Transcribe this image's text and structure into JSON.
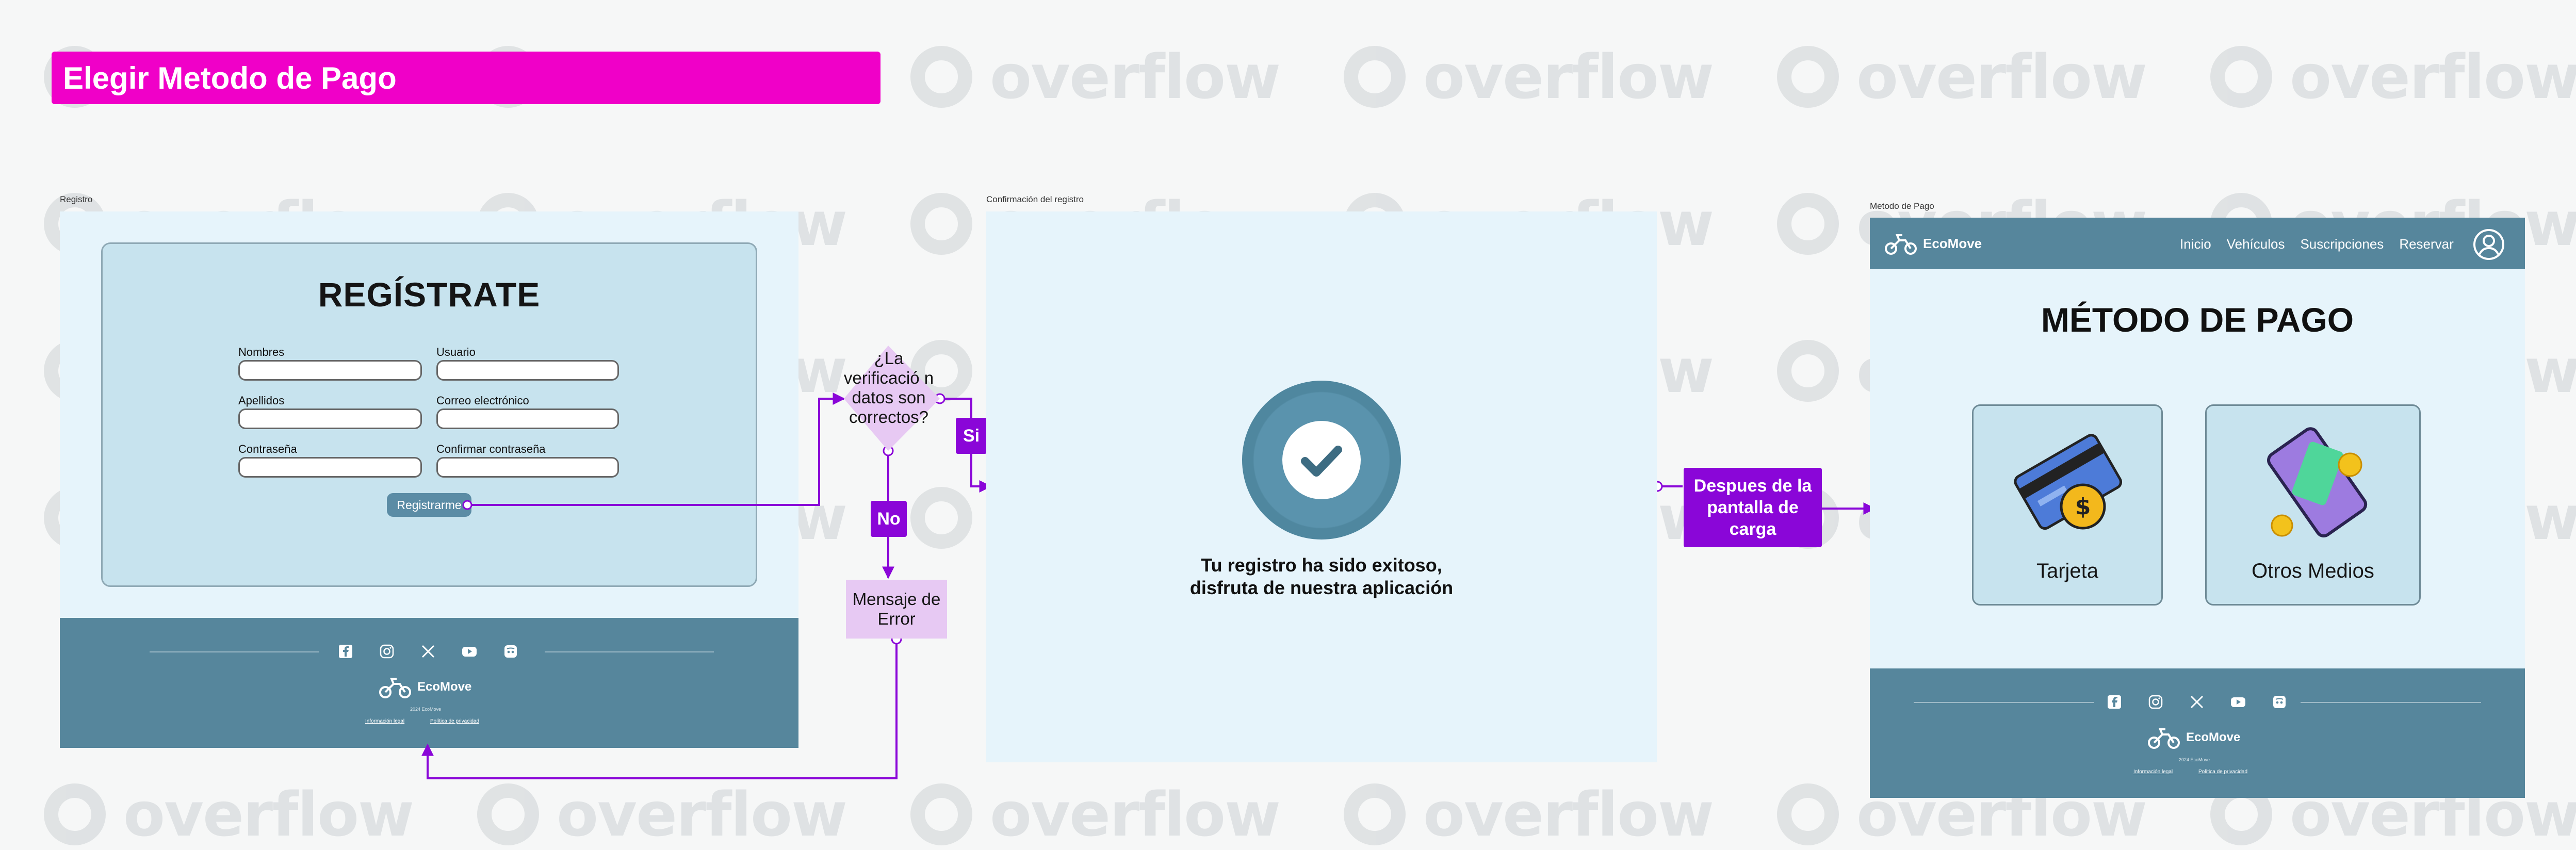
{
  "page": {
    "title": "Elegir Metodo de Pago"
  },
  "watermark": {
    "text": "overflow"
  },
  "frames": {
    "registro": {
      "label": "Registro"
    },
    "confirmacion": {
      "label": "Confirmación del registro"
    },
    "metodo_pago": {
      "label": "Metodo de Pago"
    }
  },
  "registration": {
    "title": "REGÍSTRATE",
    "fields": [
      {
        "label": "Nombres"
      },
      {
        "label": "Usuario"
      },
      {
        "label": "Apellidos"
      },
      {
        "label": "Correo electrónico"
      },
      {
        "label": "Contraseña"
      },
      {
        "label": "Confirmar contraseña"
      }
    ],
    "submit_label": "Registrarme"
  },
  "footer": {
    "brand": "EcoMove",
    "copyright": "2024 EcoMove",
    "links": [
      "Información legal",
      "Política de privacidad"
    ],
    "social_icons": [
      "facebook-icon",
      "instagram-icon",
      "x-icon",
      "youtube-icon",
      "discord-icon"
    ]
  },
  "flow": {
    "decision": "¿La verificació n datos son correctos?",
    "yes_label": "Si",
    "no_label": "No",
    "error_box": "Mensaje de Error",
    "after_load_box": "Despues de la pantalla de carga"
  },
  "confirmation": {
    "line1": "Tu registro ha sido exitoso,",
    "line2": "disfruta de nuestra aplicación"
  },
  "payment": {
    "brand": "EcoMove",
    "nav": [
      "Inicio",
      "Vehículos",
      "Suscripciones",
      "Reservar"
    ],
    "title": "MÉTODO DE PAGO",
    "options": [
      {
        "label": "Tarjeta",
        "icon": "credit-card-icon"
      },
      {
        "label": "Otros Medios",
        "icon": "phone-money-icon"
      }
    ]
  },
  "colors": {
    "title_bar": "#f000c8",
    "flow_purple": "#8a06d8",
    "footer": "#56869c",
    "card": "#c7e3ee",
    "frame_bg": "#e6f4fb"
  }
}
